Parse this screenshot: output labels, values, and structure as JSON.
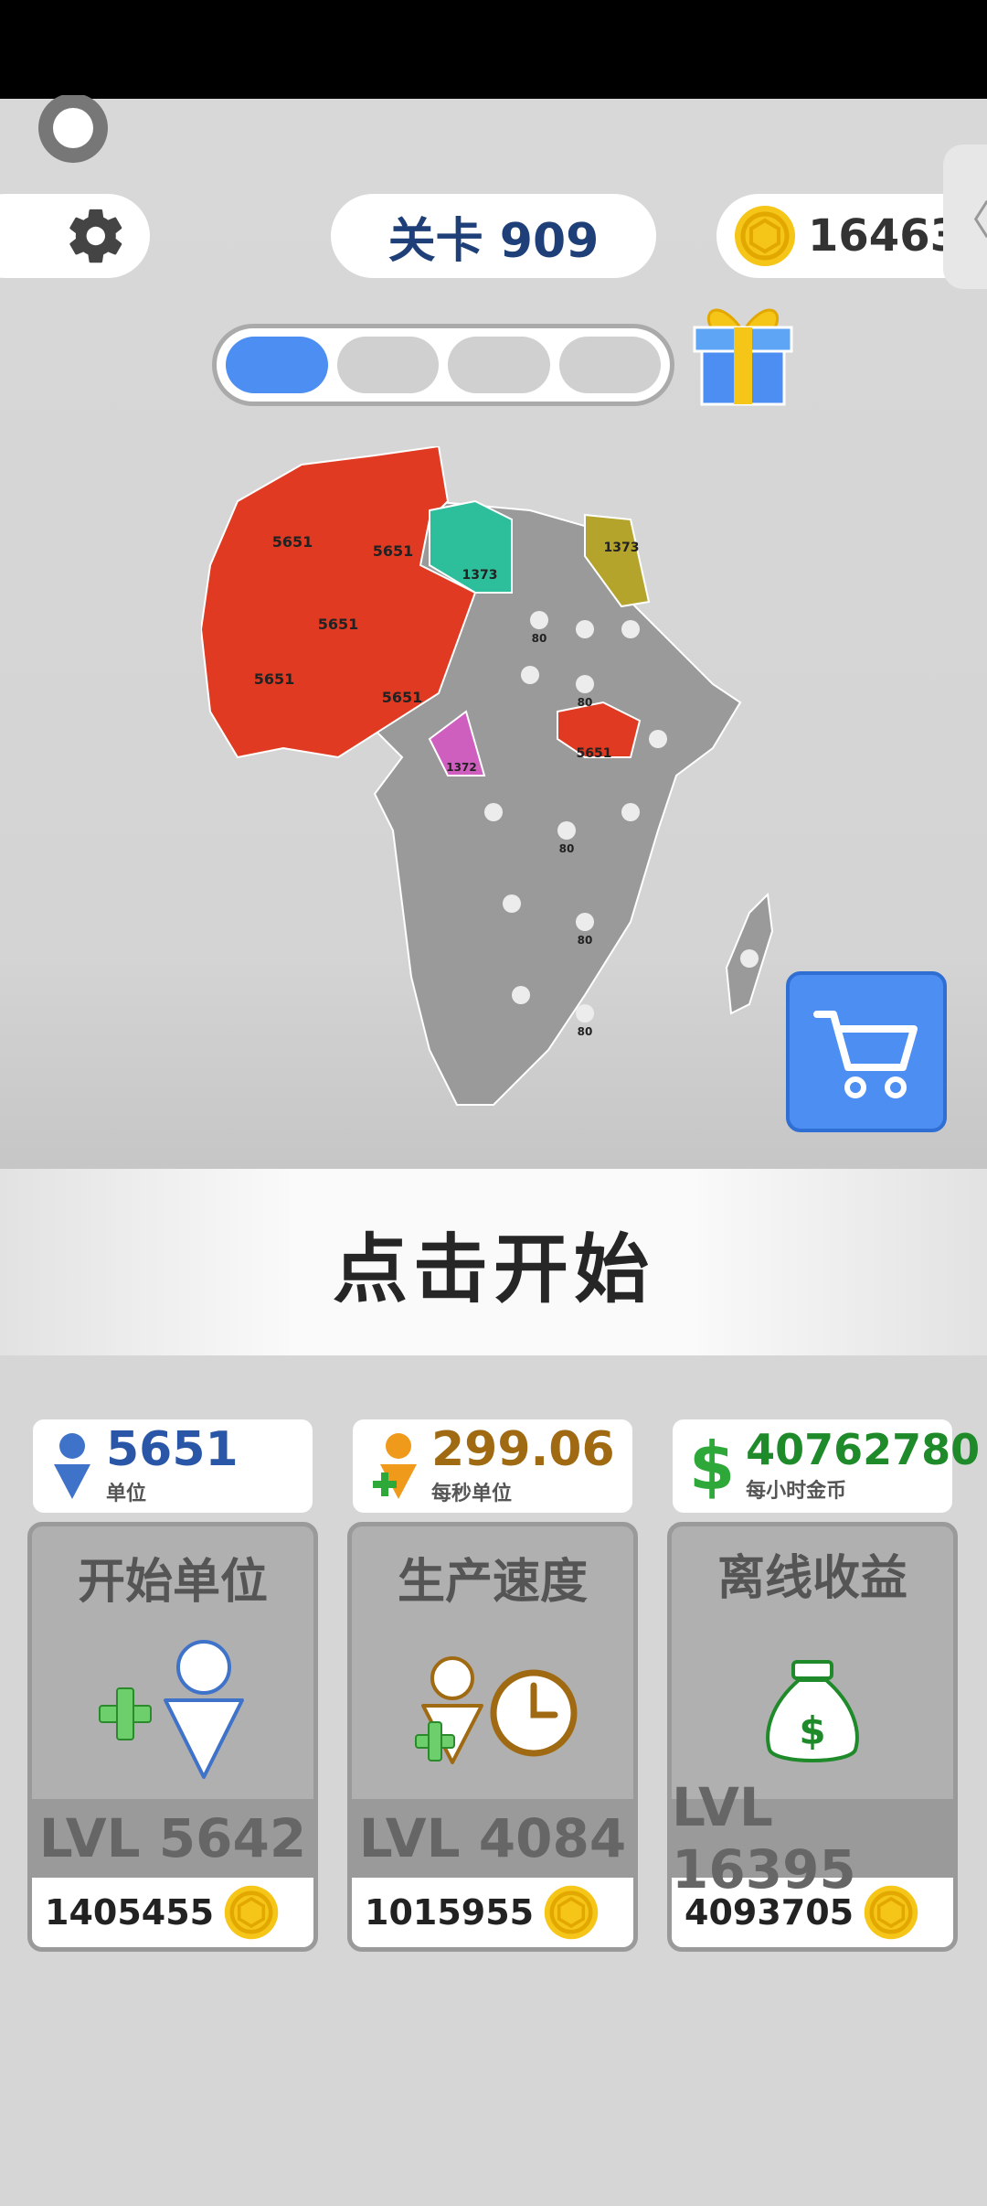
{
  "header": {
    "level_text": "关卡 909",
    "coins": "16463",
    "side_tab_glyph": "〈"
  },
  "progress": {
    "segments_total": 4,
    "segments_filled": 1
  },
  "map": {
    "regions": {
      "player": "5651",
      "teal": "1373",
      "olive": "1373",
      "magenta": "1372",
      "neutral": "80"
    },
    "colors": {
      "player": "#e03a22",
      "teal": "#2dbf9c",
      "olive": "#b5a42c",
      "magenta": "#cf5fbf",
      "neutral": "#9a9a9a"
    }
  },
  "start_prompt": "点击开始",
  "stats": {
    "units": {
      "value": "5651",
      "label": "单位",
      "color": "#2a56a8"
    },
    "per_second": {
      "value": "299.06",
      "label": "每秒单位",
      "color": "#a06a12"
    },
    "per_hour": {
      "value": "40762780",
      "label": "每小时金币",
      "color": "#1f8a2a"
    }
  },
  "upgrades": [
    {
      "title": "开始单位",
      "level": "LVL 5642",
      "cost": "1405455"
    },
    {
      "title": "生产速度",
      "level": "LVL 4084",
      "cost": "1015955"
    },
    {
      "title": "离线收益",
      "level": "LVL 16395",
      "cost": "4093705"
    }
  ],
  "icons": [
    "settings-gear-icon",
    "coin-icon",
    "gift-icon",
    "cart-icon",
    "unit-person-icon",
    "production-person-icon",
    "clock-icon",
    "money-bag-icon"
  ]
}
